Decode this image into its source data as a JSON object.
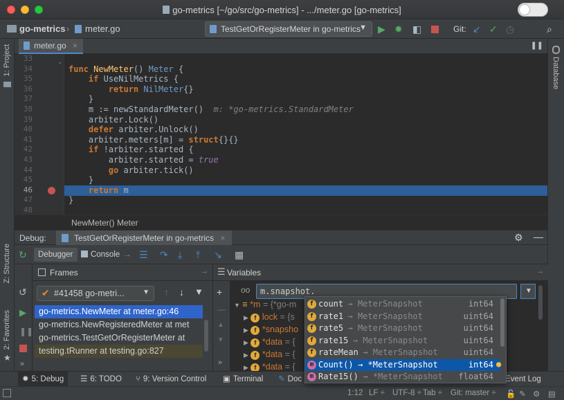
{
  "window": {
    "title": "go-metrics [~/go/src/go-metrics] - .../meter.go [go-metrics]"
  },
  "nav": {
    "project": "go-metrics",
    "file": "meter.go",
    "run_config": "TestGetOrRegisterMeter in go-metrics",
    "git_label": "Git:"
  },
  "stripes": {
    "left_top": "1: Project",
    "left_structure": "Z: Structure",
    "left_favorites": "2: Favorites",
    "right": "Database"
  },
  "editor": {
    "tab": "meter.go",
    "line_numbers": [
      "33",
      "34",
      "35",
      "36",
      "37",
      "38",
      "39",
      "40",
      "41",
      "42",
      "43",
      "44",
      "45",
      "46",
      "47",
      "48"
    ],
    "breadcrumb": "NewMeter() Meter",
    "current_line": "46"
  },
  "code": {
    "l34a": "func ",
    "l34b": "NewMeter",
    "l34c": "() ",
    "l34d": "Meter",
    "l34e": " {",
    "l35a": "    ",
    "l35b": "if ",
    "l35c": "UseNilMetrics {",
    "l36a": "        ",
    "l36b": "return ",
    "l36c": "NilMeter",
    "l36d": "{}",
    "l37": "    }",
    "l38a": "    m := newStandardMeter()  ",
    "l38b": "m: *go-metrics.StandardMeter",
    "l39": "    arbiter.Lock()",
    "l40a": "    ",
    "l40b": "defer ",
    "l40c": "arbiter.Unlock()",
    "l41a": "    arbiter.meters[m] = ",
    "l41b": "struct",
    "l41c": "{}{}",
    "l42a": "    ",
    "l42b": "if ",
    "l42c": "!arbiter.started {",
    "l43a": "        arbiter.started = ",
    "l43b": "true",
    "l44a": "        ",
    "l44b": "go ",
    "l44c": "arbiter.tick()",
    "l45": "    }",
    "l46a": "    ",
    "l46b": "return ",
    "l46c": "m",
    "l47": "}"
  },
  "debug": {
    "label": "Debug:",
    "session": "TestGetOrRegisterMeter in go-metrics",
    "tab_debugger": "Debugger",
    "tab_console": "Console",
    "frames_title": "Frames",
    "variables_title": "Variables",
    "thread": "#41458 go-metri...",
    "frames": [
      "go-metrics.NewMeter at meter.go:46",
      "go-metrics.NewRegisteredMeter at met",
      "go-metrics.TestGetOrRegisterMeter at",
      "testing.tRunner at testing.go:827"
    ],
    "eval_value": "m.snapshot.",
    "vars": [
      {
        "name": "*m",
        "value": " = {*go-m"
      },
      {
        "name": "lock",
        "value": " = {s"
      },
      {
        "name": "*snapsho",
        "value": ""
      },
      {
        "name": "*data",
        "value": " = {"
      },
      {
        "name": "*data",
        "value": " = {"
      },
      {
        "name": "*data",
        "value": " = {"
      }
    ]
  },
  "completion": {
    "items": [
      {
        "badge": "f",
        "name": "count",
        "type": "→ MeterSnapshot",
        "ret": "int64"
      },
      {
        "badge": "f",
        "name": "rate1",
        "type": "→ MeterSnapshot",
        "ret": "uint64"
      },
      {
        "badge": "f",
        "name": "rate5",
        "type": "→ MeterSnapshot",
        "ret": "uint64"
      },
      {
        "badge": "f",
        "name": "rate15",
        "type": "→ MeterSnapshot",
        "ret": "uint64"
      },
      {
        "badge": "f",
        "name": "rateMean",
        "type": "→ MeterSnapshot",
        "ret": "uint64"
      },
      {
        "badge": "m",
        "name": "Count()",
        "type": "→ *MeterSnapshot",
        "ret": "int64"
      },
      {
        "badge": "m",
        "name": "Rate15()",
        "type": "→ *MeterSnapshot",
        "ret": "float64"
      }
    ]
  },
  "toolwindows": {
    "debug": "5: Debug",
    "todo": "6: TODO",
    "vcs": "9: Version Control",
    "terminal": "Terminal",
    "doc": "Doc",
    "event_log": "Event Log"
  },
  "status": {
    "position": "1:12",
    "line_sep": "LF ÷",
    "encoding": "UTF-8 ÷",
    "indent": "Tab ÷",
    "git": "Git: master ÷"
  },
  "colors": {
    "accent": "#4a88c7",
    "exec_line": "#2d5f99",
    "selected_frame": "#2f65ca",
    "run_green": "#59a869",
    "stop_red": "#c75450"
  }
}
